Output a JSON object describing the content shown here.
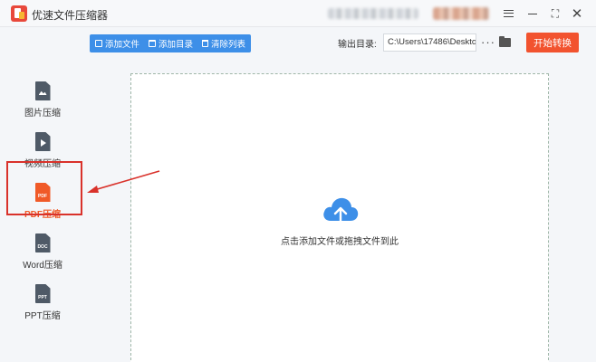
{
  "app": {
    "title": "优速文件压缩器"
  },
  "toolbar": {
    "add_file": "添加文件",
    "add_folder": "添加目录",
    "clear_list": "清除列表",
    "output_label": "输出目录:",
    "output_path": "C:\\Users\\17486\\Deskto",
    "more": "···",
    "start": "开始转换"
  },
  "sidebar": {
    "items": [
      {
        "label": "图片压缩",
        "icon": "image-file-icon"
      },
      {
        "label": "视频压缩",
        "icon": "video-file-icon"
      },
      {
        "label": "PDF压缩",
        "icon": "pdf-file-icon",
        "badge": "PDF",
        "active": true
      },
      {
        "label": "Word压缩",
        "icon": "doc-file-icon",
        "badge": "DOC"
      },
      {
        "label": "PPT压缩",
        "icon": "ppt-file-icon",
        "badge": "PPT"
      }
    ]
  },
  "drop_area": {
    "hint": "点击添加文件或拖拽文件到此"
  },
  "colors": {
    "accent": "#3d8fe8",
    "start": "#f2532f",
    "active": "#f05a28",
    "annotation": "#d9322b"
  }
}
